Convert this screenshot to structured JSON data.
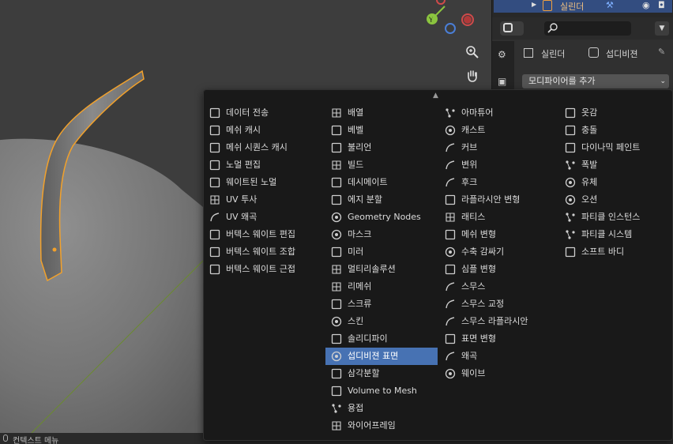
{
  "outliner": {
    "object_name": "실린더"
  },
  "properties": {
    "object_label": "실린더",
    "modifier_label": "섭디비젼",
    "add_modifier_label": "모디파이어를 추가",
    "search_placeholder": ""
  },
  "status": {
    "context_menu": "컨텍스트 메뉴"
  },
  "menu": {
    "columns": [
      [
        {
          "label": "데이터 전송",
          "icon": "data-transfer-icon"
        },
        {
          "label": "메쉬 캐시",
          "icon": "mesh-cache-icon"
        },
        {
          "label": "메쉬 시퀀스 캐시",
          "icon": "mesh-sequence-cache-icon"
        },
        {
          "label": "노멀 편집",
          "icon": "normal-edit-icon"
        },
        {
          "label": "웨이트된 노멀",
          "icon": "weighted-normal-icon"
        },
        {
          "label": "UV 투사",
          "icon": "uv-project-icon"
        },
        {
          "label": "UV 왜곡",
          "icon": "uv-warp-icon"
        },
        {
          "label": "버텍스 웨이트 편집",
          "icon": "vertex-weight-edit-icon"
        },
        {
          "label": "버텍스 웨이트 조합",
          "icon": "vertex-weight-mix-icon"
        },
        {
          "label": "버텍스 웨이트 근접",
          "icon": "vertex-weight-proximity-icon"
        }
      ],
      [
        {
          "label": "배열",
          "icon": "array-icon"
        },
        {
          "label": "베벨",
          "icon": "bevel-icon"
        },
        {
          "label": "불리언",
          "icon": "boolean-icon"
        },
        {
          "label": "빌드",
          "icon": "build-icon"
        },
        {
          "label": "데시메이트",
          "icon": "decimate-icon"
        },
        {
          "label": "에지 분할",
          "icon": "edge-split-icon"
        },
        {
          "label": "Geometry Nodes",
          "icon": "geometry-nodes-icon"
        },
        {
          "label": "마스크",
          "icon": "mask-icon"
        },
        {
          "label": "미러",
          "icon": "mirror-icon"
        },
        {
          "label": "멀티리솔루션",
          "icon": "multiresolution-icon"
        },
        {
          "label": "리메쉬",
          "icon": "remesh-icon"
        },
        {
          "label": "스크류",
          "icon": "screw-icon"
        },
        {
          "label": "스킨",
          "icon": "skin-icon"
        },
        {
          "label": "솔리디파이",
          "icon": "solidify-icon"
        },
        {
          "label": "섭디비젼 표면",
          "icon": "subdivision-surface-icon",
          "active": true
        },
        {
          "label": "삼각분할",
          "icon": "triangulate-icon"
        },
        {
          "label": "Volume to Mesh",
          "icon": "volume-to-mesh-icon"
        },
        {
          "label": "용접",
          "icon": "weld-icon"
        },
        {
          "label": "와이어프레임",
          "icon": "wireframe-icon"
        }
      ],
      [
        {
          "label": "아마튜어",
          "icon": "armature-icon"
        },
        {
          "label": "캐스트",
          "icon": "cast-icon"
        },
        {
          "label": "커브",
          "icon": "curve-icon"
        },
        {
          "label": "변위",
          "icon": "displace-icon"
        },
        {
          "label": "후크",
          "icon": "hook-icon"
        },
        {
          "label": "라플라시안 변형",
          "icon": "laplacian-deform-icon"
        },
        {
          "label": "래티스",
          "icon": "lattice-icon"
        },
        {
          "label": "메쉬 변형",
          "icon": "mesh-deform-icon"
        },
        {
          "label": "수축 감싸기",
          "icon": "shrinkwrap-icon"
        },
        {
          "label": "심플 변형",
          "icon": "simple-deform-icon"
        },
        {
          "label": "스무스",
          "icon": "smooth-icon"
        },
        {
          "label": "스무스 교정",
          "icon": "smooth-corrective-icon"
        },
        {
          "label": "스무스 라플라시안",
          "icon": "smooth-laplacian-icon"
        },
        {
          "label": "표면 변형",
          "icon": "surface-deform-icon"
        },
        {
          "label": "왜곡",
          "icon": "warp-icon"
        },
        {
          "label": "웨이브",
          "icon": "wave-icon"
        }
      ],
      [
        {
          "label": "옷감",
          "icon": "cloth-icon"
        },
        {
          "label": "충돌",
          "icon": "collision-icon"
        },
        {
          "label": "다이나믹 페인트",
          "icon": "dynamic-paint-icon"
        },
        {
          "label": "폭발",
          "icon": "explode-icon"
        },
        {
          "label": "유체",
          "icon": "fluid-icon"
        },
        {
          "label": "오션",
          "icon": "ocean-icon"
        },
        {
          "label": "파티클 인스턴스",
          "icon": "particle-instance-icon"
        },
        {
          "label": "파티클 시스템",
          "icon": "particle-system-icon"
        },
        {
          "label": "소프트 바디",
          "icon": "soft-body-icon"
        }
      ]
    ]
  },
  "colors": {
    "accent": "#4772b3",
    "selection_outline": "#f2a12b",
    "axis_x": "#d04a4a",
    "axis_y": "#8bc43f",
    "axis_z": "#4a7ed6"
  }
}
